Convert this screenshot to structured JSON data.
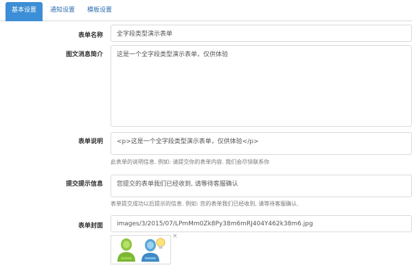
{
  "tabs": [
    {
      "label": "基本设置",
      "active": true
    },
    {
      "label": "通知设置",
      "active": false
    },
    {
      "label": "模板设置",
      "active": false
    }
  ],
  "form": {
    "name": {
      "label": "表单名称",
      "value": "全字段类型演示表单"
    },
    "summary": {
      "label": "图文消息简介",
      "value": "这是一个全字段类型演示表单，仅供体验"
    },
    "description": {
      "label": "表单说明",
      "value": "<p>这是一个全字段类型演示表单，仅供体验</p>",
      "help": "此表单的说明信息. 例如: 请提交你的表单内容. 我们会尽快联系你"
    },
    "submit_tip": {
      "label": "提交提示信息",
      "value": "您提交的表单我们已经收到, 请等待客服确认",
      "help": "表单提交成功以后提示的信息. 例如: 您的表单我们已经收到, 请等待客服确认."
    },
    "cover": {
      "label": "表单封面",
      "value": "images/3/2015/07/LPmMm0Zk8Py38m6mRJ404Y462k38m6.jpg",
      "remove": "×",
      "thumb_icon": "users-icon"
    }
  },
  "colors": {
    "accent": "#3c8ed6",
    "link": "#2a6db0",
    "border": "#d9d9d9"
  }
}
